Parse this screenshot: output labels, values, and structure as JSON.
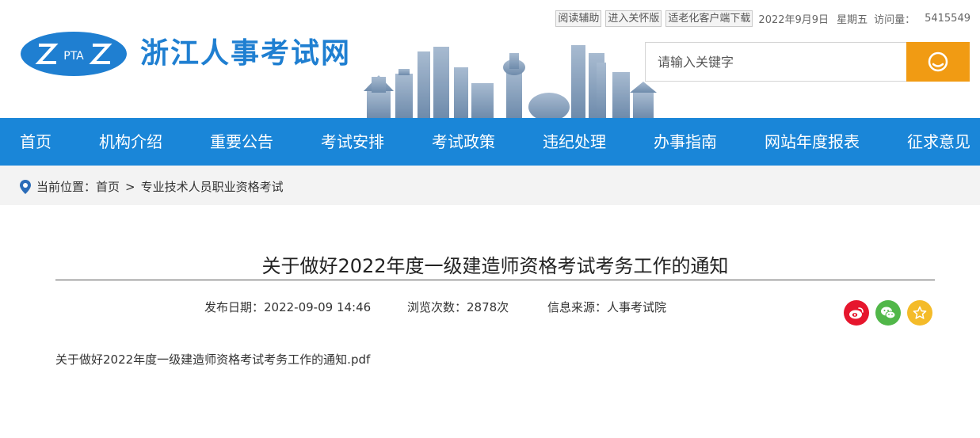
{
  "utility": {
    "reading_aid": "阅读辅助",
    "care_mode": "进入关怀版",
    "elderly_client": "适老化客户端下载",
    "date": "2022年9月9日",
    "weekday": "星期五",
    "visits_label": "访问量：",
    "visits_value": "5415549"
  },
  "logo": {
    "mark_text": "PTA",
    "site_title": "浙江人事考试网"
  },
  "search": {
    "placeholder": "请输入关键字"
  },
  "nav": {
    "items": [
      {
        "label": "首页"
      },
      {
        "label": "机构介绍"
      },
      {
        "label": "重要公告"
      },
      {
        "label": "考试安排"
      },
      {
        "label": "考试政策"
      },
      {
        "label": "违纪处理"
      },
      {
        "label": "办事指南"
      },
      {
        "label": "网站年度报表"
      },
      {
        "label": "征求意见"
      }
    ]
  },
  "breadcrumb": {
    "label": "当前位置：",
    "home": "首页",
    "separator": ">",
    "current": "专业技术人员职业资格考试"
  },
  "article": {
    "title": "关于做好2022年度一级建造师资格考试考务工作的通知",
    "publish_date": "发布日期：2022-09-09 14:46",
    "views": "浏览次数：2878次",
    "source": "信息来源：人事考试院",
    "attachment": "关于做好2022年度一级建造师资格考试考务工作的通知.pdf"
  },
  "colors": {
    "brand_blue": "#1a86d8",
    "search_orange": "#f19b13",
    "weibo_red": "#e6162d",
    "wechat_green": "#51b749",
    "favorite_yellow": "#f4bb29"
  },
  "icons": [
    "pta-logo-icon",
    "search-icon",
    "location-pin-icon",
    "weibo-icon",
    "wechat-icon",
    "star-icon"
  ]
}
